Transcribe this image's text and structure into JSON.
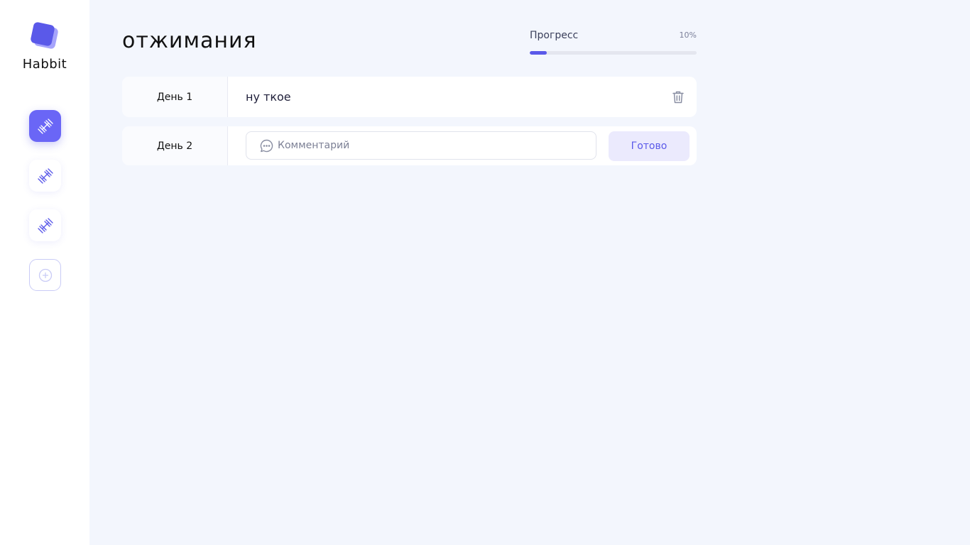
{
  "app": {
    "name": "Habbit",
    "accent_color": "#5a59e9"
  },
  "sidebar": {
    "habits": [
      {
        "icon": "dumbbell-icon",
        "active": true
      },
      {
        "icon": "dumbbell-icon",
        "active": false
      },
      {
        "icon": "dumbbell-icon",
        "active": false
      }
    ],
    "add_icon": "plus-circle-icon"
  },
  "header": {
    "title": "отжимания",
    "progress": {
      "label": "Прогресс",
      "percent_text": "10%",
      "value": 0.1
    }
  },
  "days": [
    {
      "label": "День 1",
      "comment": "ну ткое",
      "delete_icon": "trash-icon"
    },
    {
      "label": "День 2",
      "comment_placeholder": "Комментарий",
      "comment_icon": "speech-bubble-icon",
      "done_label": "Готово"
    }
  ]
}
